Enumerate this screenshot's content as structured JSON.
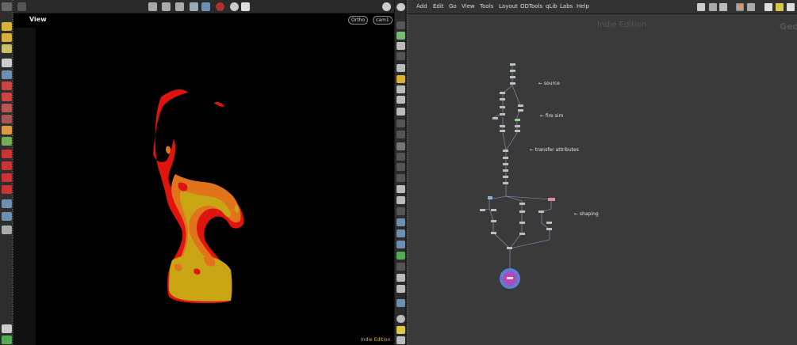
{
  "viewer": {
    "title": "View",
    "projection_menu": "Ortho",
    "camera_menu": "cam1",
    "license_label": "Indie Edition"
  },
  "network": {
    "menu": [
      "Add",
      "Edit",
      "Go",
      "View",
      "Tools",
      "Layout",
      "ODTools",
      "qLib",
      "Labs",
      "Help"
    ],
    "watermark": "Indie Edition",
    "context_label": "Geo",
    "stickies": {
      "source": "← source",
      "fire_sim": "← fire sim",
      "transfer": "← transfer attributes",
      "shaping": "← shaping"
    }
  },
  "colors": {
    "fire_red": "#e0140f",
    "fire_orange": "#e0731c",
    "fire_yellow": "#c9a413",
    "viewport_bg": "#000000",
    "network_bg": "#3a3a3a",
    "selected_node": "#5b7fd6"
  }
}
